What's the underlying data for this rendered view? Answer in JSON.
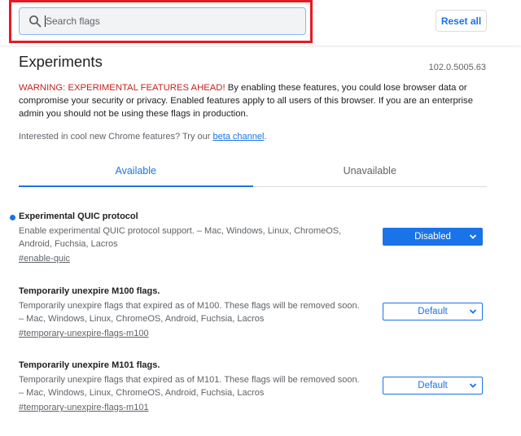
{
  "header": {
    "search": {
      "placeholder": "Search flags",
      "value": ""
    },
    "reset_label": "Reset all"
  },
  "main": {
    "title": "Experiments",
    "version": "102.0.5005.63",
    "warning_red": "WARNING: EXPERIMENTAL FEATURES AHEAD!",
    "warning_rest": " By enabling these features, you could lose browser data or compromise your security or privacy. Enabled features apply to all users of this browser. If you are an enterprise admin you should not be using these flags in production.",
    "interest_prefix": "Interested in cool new Chrome features? Try our ",
    "interest_link": "beta channel",
    "interest_suffix": ".",
    "tabs": [
      {
        "label": "Available",
        "active": true
      },
      {
        "label": "Unavailable",
        "active": false
      }
    ],
    "experiments": [
      {
        "title": "Experimental QUIC protocol",
        "description": "Enable experimental QUIC protocol support. – Mac, Windows, Linux, ChromeOS, Android, Fuchsia, Lacros",
        "link": "#enable-quic",
        "select_value": "Disabled",
        "modified": true
      },
      {
        "title": "Temporarily unexpire M100 flags.",
        "description": "Temporarily unexpire flags that expired as of M100. These flags will be removed soon. – Mac, Windows, Linux, ChromeOS, Android, Fuchsia, Lacros",
        "link": "#temporary-unexpire-flags-m100",
        "select_value": "Default",
        "modified": false
      },
      {
        "title": "Temporarily unexpire M101 flags.",
        "description": "Temporarily unexpire flags that expired as of M101. These flags will be removed soon. – Mac, Windows, Linux, ChromeOS, Android, Fuchsia, Lacros",
        "link": "#temporary-unexpire-flags-m101",
        "select_value": "Default",
        "modified": false
      }
    ]
  },
  "colors": {
    "accent": "#1a73e8",
    "warning": "#c5221f",
    "highlight": "#e51b23"
  },
  "icons": {
    "search": "search-icon",
    "chevron": "chevron-down-icon"
  }
}
